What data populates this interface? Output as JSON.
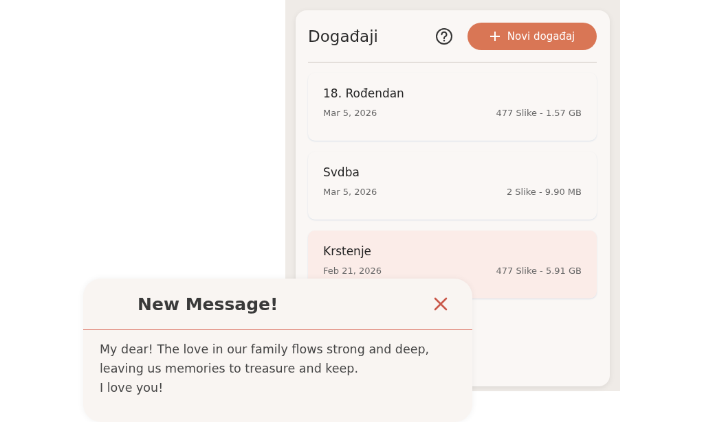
{
  "panel": {
    "title": "Događaji",
    "new_button": {
      "label": "Novi događaj"
    }
  },
  "events": [
    {
      "name": "18. Rođendan",
      "date": "Mar 5, 2026",
      "info": "477 Slike - 1.57 GB",
      "selected": false
    },
    {
      "name": "Svdba",
      "date": "Mar 5, 2026",
      "info": "2 Slike - 9.90 MB",
      "selected": false
    },
    {
      "name": "Krstenje",
      "date": "Feb 21, 2026",
      "info": "477 Slike - 5.91 GB",
      "selected": true
    }
  ],
  "message": {
    "title": "New Message!",
    "body_lines": [
      "My dear! The love in our family flows strong and deep, leaving us memories to treasure and keep.",
      "I love you!"
    ]
  }
}
